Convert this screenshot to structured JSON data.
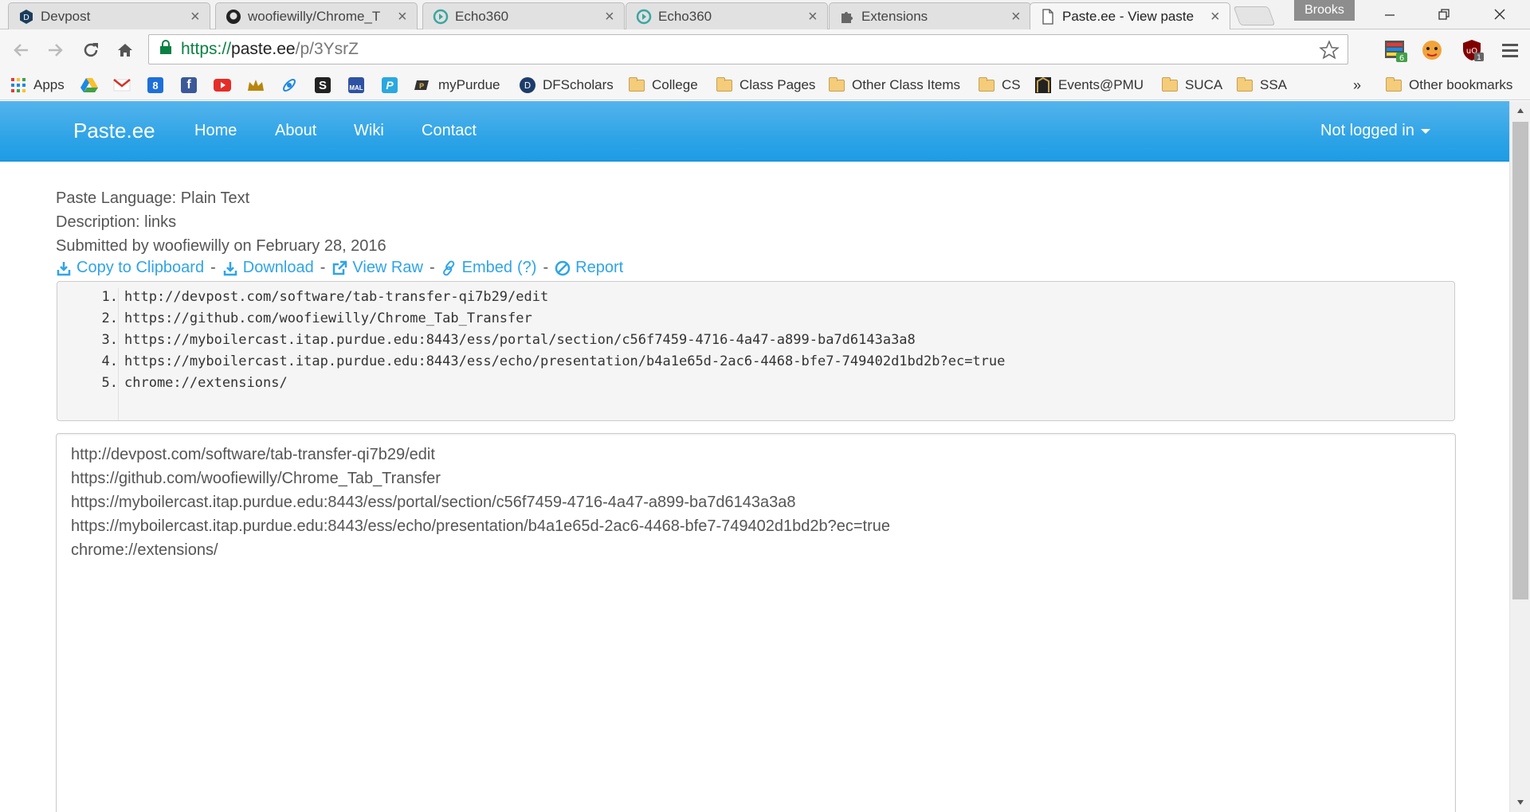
{
  "browser": {
    "tabs": [
      {
        "title": "Devpost",
        "icon": "devpost-icon"
      },
      {
        "title": "woofiewilly/Chrome_T",
        "icon": "github-icon"
      },
      {
        "title": "Echo360",
        "icon": "echo360-icon"
      },
      {
        "title": "Echo360",
        "icon": "echo360-icon"
      },
      {
        "title": "Extensions",
        "icon": "puzzle-icon"
      },
      {
        "title": "Paste.ee - View paste",
        "icon": "page-icon"
      }
    ],
    "profile": "Brooks",
    "url": {
      "scheme": "https://",
      "host": "paste.ee",
      "path": "/p/3YsrZ"
    },
    "bookmarks": [
      {
        "label": "Apps",
        "icon": "apps-grid-icon"
      },
      {
        "label": "",
        "icon": "google-drive-icon"
      },
      {
        "label": "",
        "icon": "gmail-icon"
      },
      {
        "label": "",
        "icon": "google-calendar-icon"
      },
      {
        "label": "",
        "icon": "facebook-icon"
      },
      {
        "label": "",
        "icon": "youtube-icon"
      },
      {
        "label": "",
        "icon": "crown-icon"
      },
      {
        "label": "",
        "icon": "rocket-icon"
      },
      {
        "label": "",
        "icon": "s-square-icon"
      },
      {
        "label": "",
        "icon": "mal-icon"
      },
      {
        "label": "",
        "icon": "paypal-icon"
      },
      {
        "label": "myPurdue",
        "icon": "purdue-icon"
      },
      {
        "label": "DFScholars",
        "icon": "dfscholars-icon"
      },
      {
        "label": "College",
        "icon": "folder-icon"
      },
      {
        "label": "Class Pages",
        "icon": "folder-icon"
      },
      {
        "label": "Other Class Items",
        "icon": "folder-icon"
      },
      {
        "label": "CS",
        "icon": "folder-icon"
      },
      {
        "label": "Events@PMU",
        "icon": "events-icon"
      },
      {
        "label": "SUCA",
        "icon": "folder-icon"
      },
      {
        "label": "SSA",
        "icon": "folder-icon"
      }
    ],
    "bookmarks_overflow": "»",
    "other_bookmarks": "Other bookmarks",
    "extension_badge_1": "6",
    "extension_badge_2": "1"
  },
  "site": {
    "brand": "Paste.ee",
    "nav": [
      "Home",
      "About",
      "Wiki",
      "Contact"
    ],
    "user_menu": "Not logged in"
  },
  "paste": {
    "language": "Paste Language: Plain Text",
    "description": "Description: links",
    "submitted": "Submitted by woofiewilly on February 28, 2016",
    "actions": {
      "copy": "Copy to Clipboard",
      "download": "Download",
      "view_raw": "View Raw",
      "embed": "Embed",
      "embed_help": "(?)",
      "report": "Report",
      "separator": "-"
    },
    "lines": [
      {
        "num": "1.",
        "text": "http://devpost.com/software/tab-transfer-qi7b29/edit"
      },
      {
        "num": "2.",
        "text": "https://github.com/woofiewilly/Chrome_Tab_Transfer"
      },
      {
        "num": "3.",
        "text": "https://myboilercast.itap.purdue.edu:8443/ess/portal/section/c56f7459-4716-4a47-a899-ba7d6143a3a8"
      },
      {
        "num": "4.",
        "text": "https://myboilercast.itap.purdue.edu:8443/ess/echo/presentation/b4a1e65d-2ac6-4468-bfe7-749402d1bd2b?ec=true"
      },
      {
        "num": "5.",
        "text": "chrome://extensions/"
      }
    ]
  },
  "colors": {
    "navbar": "#2fa4e7",
    "link": "#2fa4e7",
    "text": "#555555"
  }
}
